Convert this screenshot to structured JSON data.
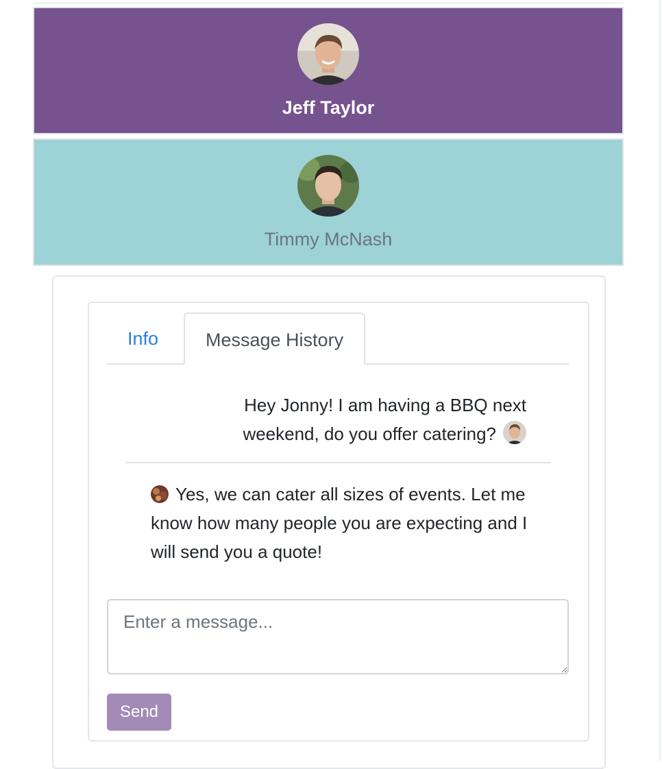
{
  "colors": {
    "jeff_bg": "#76528e",
    "jeff_text": "#ffffff",
    "timmy_bg": "#9dd2d6",
    "timmy_text": "#6c757d",
    "tab_active_link": "#2c7be5",
    "send_button": "#a48ab6"
  },
  "contacts": [
    {
      "name": "Jeff Taylor",
      "avatar_icon": "user-avatar-photo",
      "selected": true
    },
    {
      "name": "Timmy McNash",
      "avatar_icon": "user-avatar-photo",
      "selected": false
    }
  ],
  "tabs": [
    {
      "label": "Info",
      "active": false
    },
    {
      "label": "Message History",
      "active": true
    }
  ],
  "messages": [
    {
      "direction": "sent",
      "text": "Hey Jonny! I am having a BBQ next weekend, do you offer catering?"
    },
    {
      "direction": "received",
      "text": "Yes, we can cater all sizes of events. Let me know how many people you are expecting and I will send you a quote!"
    }
  ],
  "composer": {
    "placeholder": "Enter a message...",
    "value": "",
    "send_label": "Send"
  }
}
